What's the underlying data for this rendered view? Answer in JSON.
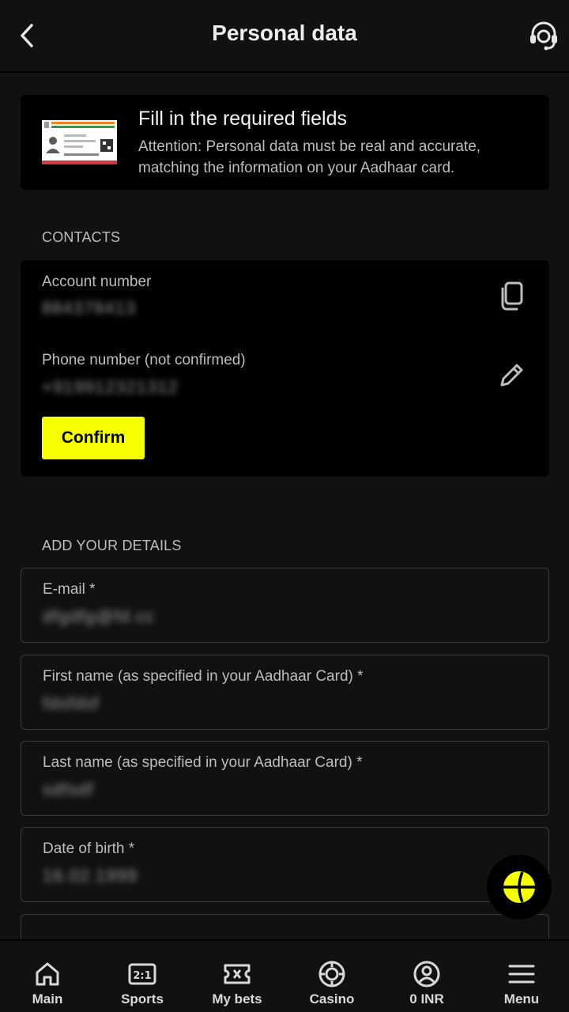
{
  "header": {
    "title": "Personal data"
  },
  "banner": {
    "title": "Fill in the required fields",
    "text": "Attention: Personal data must be real and accurate, matching the information on your Aadhaar card."
  },
  "contacts": {
    "section_label": "CONTACTS",
    "account_label": "Account number",
    "account_value": "884378413",
    "phone_label": "Phone number (not confirmed)",
    "phone_value": "+919912321312",
    "confirm_label": "Confirm"
  },
  "details": {
    "section_label": "ADD YOUR DETAILS",
    "fields": [
      {
        "label": "E-mail *",
        "value": "dfgdfg@fd.cc"
      },
      {
        "label": "First name (as specified in your Aadhaar Card) *",
        "value": "fdsfdsf"
      },
      {
        "label": "Last name (as specified in your Aadhaar Card) *",
        "value": "sdfsdf"
      },
      {
        "label": "Date of birth *",
        "value": "16.02.1999"
      }
    ]
  },
  "nav": [
    {
      "label": "Main",
      "icon": "home-icon"
    },
    {
      "label": "Sports",
      "icon": "scoreboard-icon"
    },
    {
      "label": "My bets",
      "icon": "ticket-icon"
    },
    {
      "label": "Casino",
      "icon": "chip-icon"
    },
    {
      "label": "0 INR",
      "icon": "user-icon"
    },
    {
      "label": "Menu",
      "icon": "menu-icon"
    }
  ],
  "colors": {
    "accent": "#f5ff00",
    "background": "#111111",
    "card": "#000000"
  }
}
